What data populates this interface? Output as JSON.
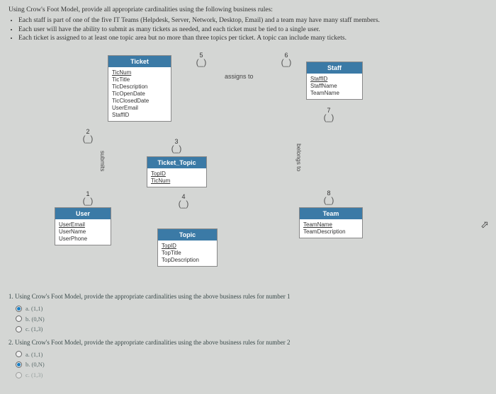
{
  "instructions": {
    "lead": "Using Crow's Foot Model, provide all appropriate cardinalities using the following business rules:",
    "rules": [
      "Each staff is part of one of the five IT Teams (Helpdesk, Server, Network, Desktop, Email) and a team may have many staff members.",
      "Each user will have the ability to submit as many tickets as needed, and each ticket must be tied to a single user.",
      "Each ticket is assigned to at least one topic area but no more than three topics per ticket. A topic can include many tickets."
    ]
  },
  "entities": {
    "ticket": {
      "name": "Ticket",
      "attrs": [
        "TicNum",
        "TicTitle",
        "TicDescription",
        "TicOpenDate",
        "TicClosedDate",
        "UserEmail",
        "StaffID"
      ]
    },
    "staff": {
      "name": "Staff",
      "attrs": [
        "StaffID",
        "StaffName",
        "TeamName"
      ]
    },
    "ticket_topic": {
      "name": "Ticket_Topic",
      "attrs": [
        "TopID",
        "TicNum"
      ]
    },
    "user": {
      "name": "User",
      "attrs": [
        "UserEmail",
        "UserName",
        "UserPhone"
      ]
    },
    "team": {
      "name": "Team",
      "attrs": [
        "TeamName",
        "TeamDescription"
      ]
    },
    "topic": {
      "name": "Topic",
      "attrs": [
        "TopID",
        "TopTitle",
        "TopDescription"
      ]
    }
  },
  "markers": {
    "m1": {
      "num": "1",
      "sym": "(_)"
    },
    "m2": {
      "num": "2",
      "sym": "(_)"
    },
    "m3": {
      "num": "3",
      "sym": "(_)"
    },
    "m4": {
      "num": "4",
      "sym": "(_)"
    },
    "m5": {
      "num": "5",
      "sym": "(_)"
    },
    "m6": {
      "num": "6",
      "sym": "(_)"
    },
    "m7": {
      "num": "7",
      "sym": "(_)"
    },
    "m8": {
      "num": "8",
      "sym": "(_)"
    }
  },
  "rel": {
    "assigns": "assigns to",
    "submits": "submits",
    "belongs": "belongs to"
  },
  "questions": {
    "q1": {
      "prompt": "1. Using Crow's Foot Model, provide the appropriate cardinalities using the above business rules for number 1",
      "opts": [
        {
          "label": "a. (1,1)",
          "selected": true
        },
        {
          "label": "b. (0,N)",
          "selected": false
        },
        {
          "label": "c. (1,3)",
          "selected": false
        }
      ]
    },
    "q2": {
      "prompt": "2. Using Crow's Foot Model, provide the appropriate cardinalities using the above business rules for number 2",
      "opts": [
        {
          "label": "a. (1,1)",
          "selected": false
        },
        {
          "label": "b. (0,N)",
          "selected": true
        },
        {
          "label": "c. (1,3)",
          "selected": false
        }
      ]
    }
  }
}
